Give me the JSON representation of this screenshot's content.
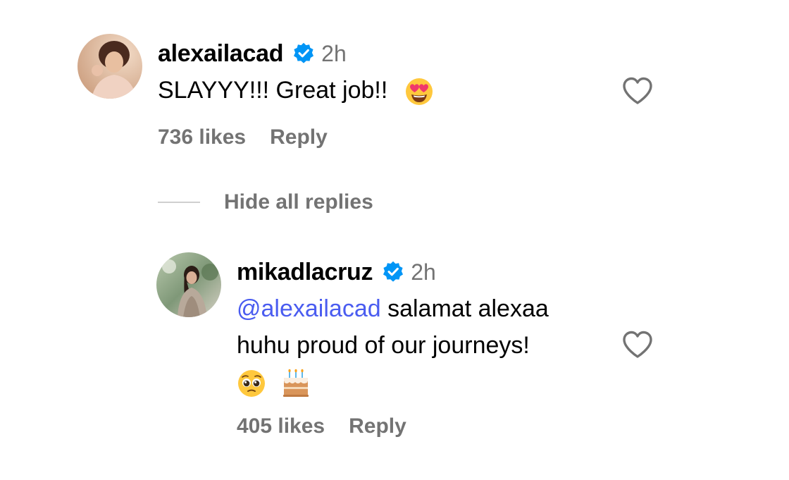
{
  "comments": [
    {
      "avatar_icon": "profile-photo-woman",
      "username": "alexailacad",
      "verified_icon": "verified-badge-icon",
      "timestamp": "2h",
      "text": "SLAYYY!!! Great job!!",
      "emoji_names": [
        "heart-eyes-emoji"
      ],
      "likes": "736 likes",
      "reply_label": "Reply",
      "like_icon": "heart-outline-icon"
    }
  ],
  "replies_toggle": {
    "label": "Hide all replies"
  },
  "replies": [
    {
      "avatar_icon": "profile-photo-woman",
      "username": "mikadlacruz",
      "verified_icon": "verified-badge-icon",
      "timestamp": "2h",
      "mention": "@alexailacad",
      "text_line1": " salamat alexaa",
      "text_line2": "huhu proud of our journeys!",
      "emoji_names": [
        "pleading-face-emoji",
        "birthday-cake-emoji"
      ],
      "likes": "405 likes",
      "reply_label": "Reply",
      "like_icon": "heart-outline-icon"
    }
  ],
  "colors": {
    "secondary_text": "#737373",
    "mention": "#4a5cf0",
    "verified": "#0095f6"
  }
}
